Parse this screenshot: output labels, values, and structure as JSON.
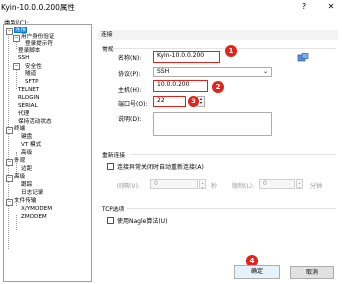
{
  "window": {
    "title": "Kyin-10.0.0.200属性",
    "help_label": "?",
    "close_label": "✕"
  },
  "category_label": "类别(C):",
  "tree": [
    {
      "label": "连接",
      "selected": true
    },
    {
      "label": "用户身份验证"
    },
    {
      "label": "登录提示符"
    },
    {
      "label": "登录脚本"
    },
    {
      "label": "SSH"
    },
    {
      "label": "安全性"
    },
    {
      "label": "隧道"
    },
    {
      "label": "SFTP"
    },
    {
      "label": "TELNET"
    },
    {
      "label": "RLOGIN"
    },
    {
      "label": "SERIAL"
    },
    {
      "label": "代理"
    },
    {
      "label": "保持活动状态"
    },
    {
      "label": "终端"
    },
    {
      "label": "键盘"
    },
    {
      "label": "VT 模式"
    },
    {
      "label": "高级"
    },
    {
      "label": "外观"
    },
    {
      "label": "边距"
    },
    {
      "label": "高级"
    },
    {
      "label": "跟踪"
    },
    {
      "label": "日志记录"
    },
    {
      "label": "文件传输"
    },
    {
      "label": "X/YMODEM"
    },
    {
      "label": "ZMODEM"
    }
  ],
  "header": {
    "title": "连接"
  },
  "general": {
    "title": "常规",
    "name_label": "名称(N):",
    "name_value": "Kyin-10.0.0.200",
    "protocol_label": "协议(P):",
    "protocol_value": "SSH",
    "host_label": "主机(H):",
    "host_value": "10.0.0.200",
    "port_label": "端口号(O):",
    "port_value": "22",
    "desc_label": "说明(D):"
  },
  "reconnect": {
    "title": "重新连接",
    "checkbox_label": "连接异常关闭时自动重新连接(A)",
    "interval_label": "间隔(V):",
    "interval_value": "0",
    "interval_unit": "秒",
    "limit_label": "限制(L):",
    "limit_value": "0",
    "limit_unit": "分钟"
  },
  "tcp": {
    "title": "TCP选项",
    "nagle_label": "使用Nagle算法(U)"
  },
  "buttons": {
    "ok": "确定",
    "cancel": "取消"
  },
  "badges": [
    "1",
    "2",
    "3",
    "4"
  ],
  "colors": {
    "accent": "#e0241b",
    "selection": "#0078d7"
  }
}
